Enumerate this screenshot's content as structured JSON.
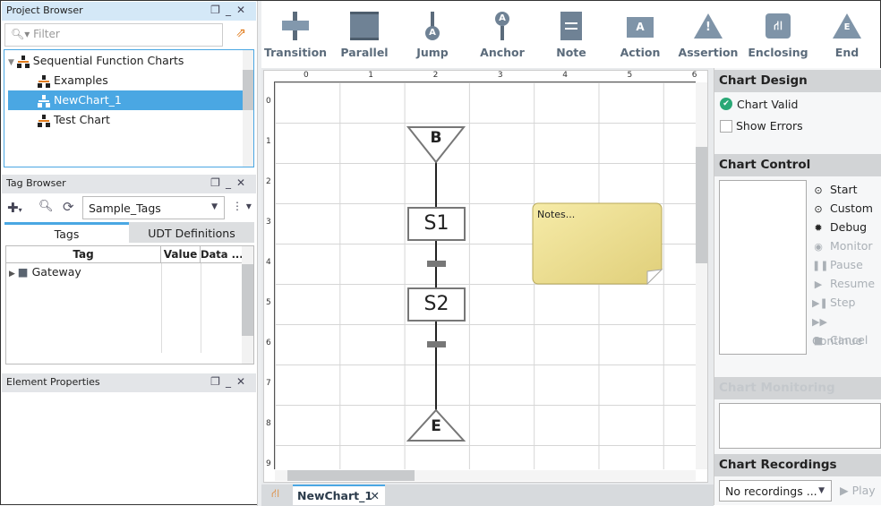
{
  "project_browser": {
    "title": "Project Browser",
    "filter_placeholder": "Filter",
    "tree": [
      {
        "label": "Sequential Function Charts"
      },
      {
        "label": "Examples"
      },
      {
        "label": "NewChart_1",
        "selected": true
      },
      {
        "label": "Test Chart"
      }
    ]
  },
  "tag_browser": {
    "title": "Tag Browser",
    "provider": "Sample_Tags",
    "tabs": [
      "Tags",
      "UDT Definitions"
    ],
    "columns": [
      "Tag",
      "Value",
      "Data ..."
    ],
    "rows": [
      {
        "tag": "Gateway"
      }
    ]
  },
  "element_properties": {
    "title": "Element Properties"
  },
  "toolbar": {
    "items": [
      {
        "label": "Transition",
        "icon": "transition-icon"
      },
      {
        "label": "Parallel",
        "icon": "parallel-icon"
      },
      {
        "label": "Jump",
        "icon": "jump-icon"
      },
      {
        "label": "Anchor",
        "icon": "anchor-icon"
      },
      {
        "label": "Note",
        "icon": "note-icon"
      },
      {
        "label": "Action",
        "icon": "action-icon"
      },
      {
        "label": "Assertion",
        "icon": "assertion-icon"
      },
      {
        "label": "Enclosing",
        "icon": "enclosing-icon"
      },
      {
        "label": "End",
        "icon": "end-icon"
      }
    ]
  },
  "canvas": {
    "col_labels": [
      "0",
      "1",
      "2",
      "3",
      "4",
      "5",
      "6"
    ],
    "row_labels": [
      "0",
      "1",
      "2",
      "3",
      "4",
      "5",
      "6",
      "7",
      "8",
      "9"
    ],
    "begin_label": "B",
    "steps": [
      "S1",
      "S2"
    ],
    "end_label": "E",
    "note_text": "Notes..."
  },
  "editor_tab": {
    "label": "NewChart_1"
  },
  "chart_design": {
    "title": "Chart Design",
    "status": "Chart Valid",
    "show_errors": "Show Errors",
    "status_color": "#2aa876"
  },
  "chart_control": {
    "title": "Chart Control",
    "actions": [
      {
        "label": "Start",
        "enabled": true
      },
      {
        "label": "Custom",
        "enabled": true
      },
      {
        "label": "Debug",
        "enabled": true
      },
      {
        "label": "Monitor",
        "enabled": false
      },
      {
        "label": "Pause",
        "enabled": false
      },
      {
        "label": "Resume",
        "enabled": false
      },
      {
        "label": "Step",
        "enabled": false
      },
      {
        "label": "Continue",
        "enabled": false
      },
      {
        "label": "Cancel",
        "enabled": false
      }
    ]
  },
  "chart_monitoring": {
    "title": "Chart Monitoring"
  },
  "chart_recordings": {
    "title": "Chart Recordings",
    "selected": "No recordings ...",
    "play": "Play"
  }
}
